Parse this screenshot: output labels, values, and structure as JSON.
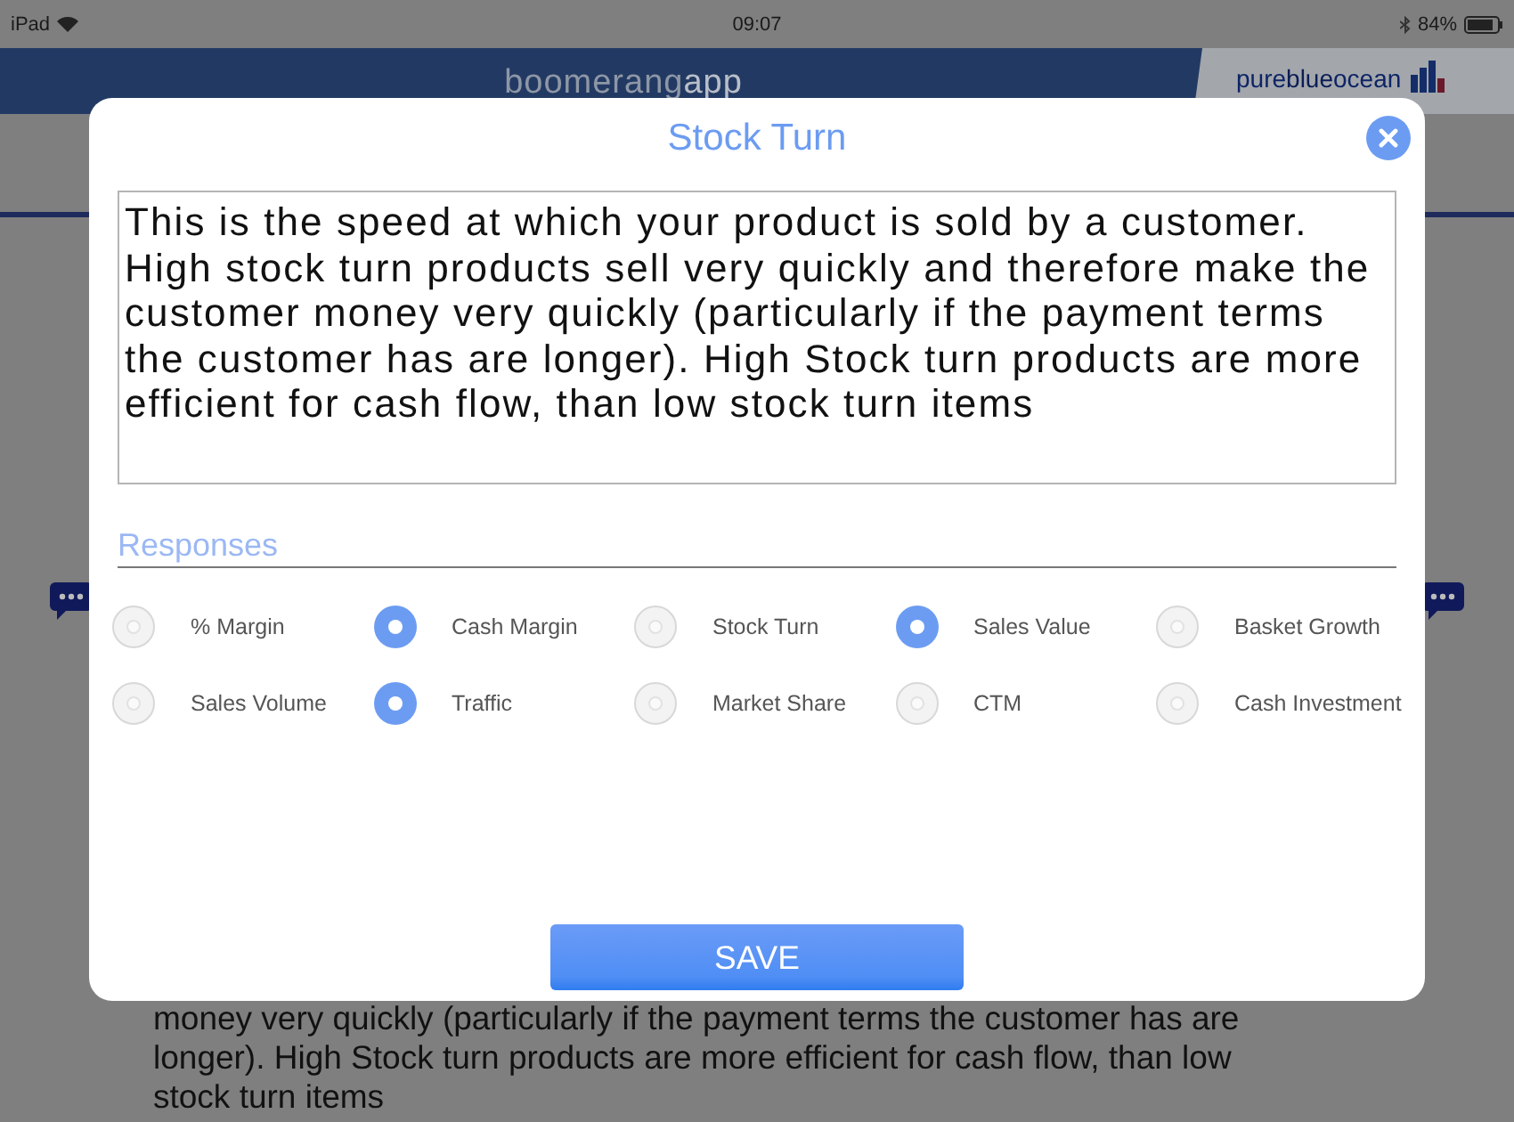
{
  "status_bar": {
    "device": "iPad",
    "time": "09:07",
    "battery": "84%"
  },
  "header": {
    "app_name": "boomerang",
    "app_suffix": "app",
    "brand": [
      "pure",
      "blue",
      "ocean"
    ]
  },
  "background_text": [
    "money very quickly (particularly if the payment terms the customer has are",
    "longer).  High Stock turn products are more efficient for cash flow, than low",
    "stock turn items"
  ],
  "dialog": {
    "title": "Stock Turn",
    "description": "This is the speed at which your product is sold by a customer.  High stock turn products sell very quickly and therefore make the customer money very quickly (particularly if the payment terms the customer has are longer).  High Stock turn products are more efficient for cash flow, than low stock turn items",
    "responses_label": "Responses",
    "responses": [
      {
        "label": "% Margin",
        "selected": false
      },
      {
        "label": "Cash Margin",
        "selected": true
      },
      {
        "label": "Stock Turn",
        "selected": false
      },
      {
        "label": "Sales Value",
        "selected": true
      },
      {
        "label": "Basket Growth",
        "selected": false
      },
      {
        "label": "Sales Volume",
        "selected": false
      },
      {
        "label": "Traffic",
        "selected": true
      },
      {
        "label": "Market Share",
        "selected": false
      },
      {
        "label": "CTM",
        "selected": false
      },
      {
        "label": "Cash Investment",
        "selected": false
      }
    ],
    "save_button": "SAVE"
  }
}
